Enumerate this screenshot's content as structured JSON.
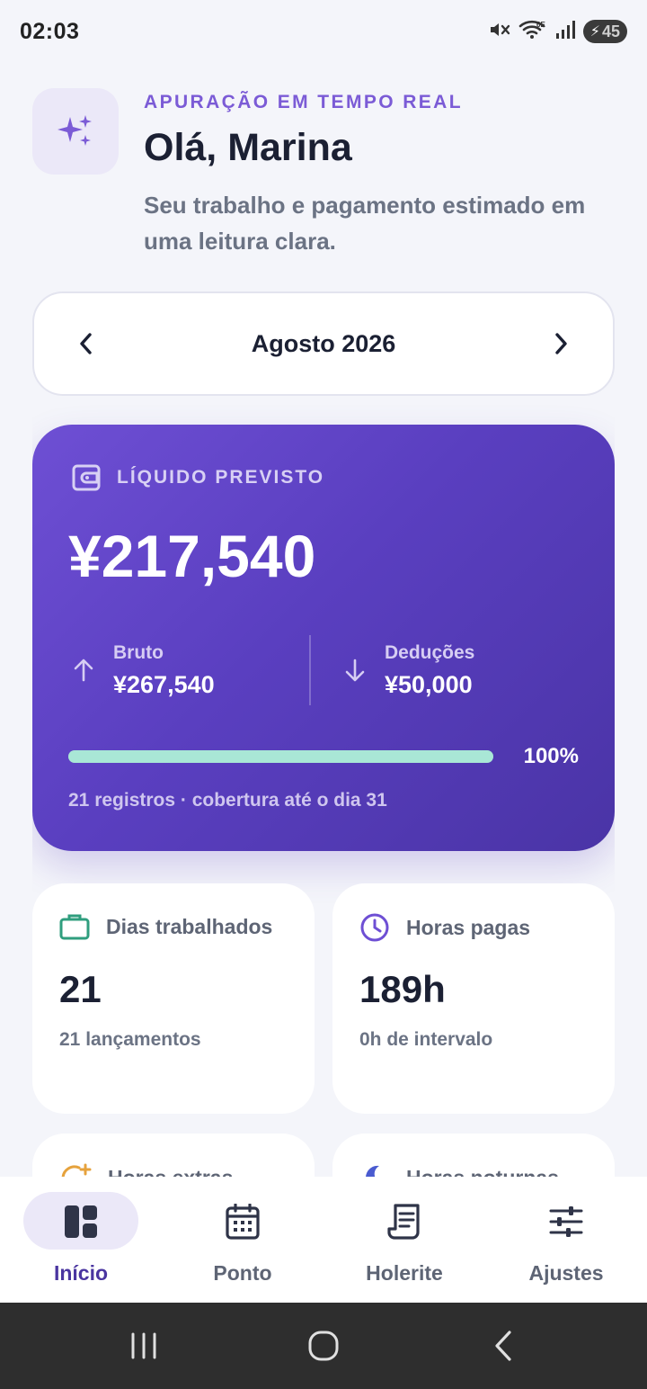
{
  "status_bar": {
    "time": "02:03",
    "battery": "45",
    "icons": [
      "mute-icon",
      "wifi-icon",
      "signal-icon",
      "battery-charging-icon"
    ]
  },
  "header": {
    "eyebrow": "APURAÇÃO EM TEMPO REAL",
    "greeting": "Olá, Marina",
    "subtitle": "Seu trabalho e pagamento estimado em uma leitura clara.",
    "icon": "sparkles-icon"
  },
  "month_selector": {
    "label": "Agosto 2026",
    "prev_icon": "chevron-left-icon",
    "next_icon": "chevron-right-icon"
  },
  "summary": {
    "label": "LÍQUIDO PREVISTO",
    "net_value": "¥217,540",
    "gross_label": "Bruto",
    "gross_value": "¥267,540",
    "deductions_label": "Deduções",
    "deductions_value": "¥50,000",
    "progress_percent": 100,
    "progress_label": "100%",
    "footer": "21 registros · cobertura até o dia 31",
    "accent_color": "#6e4fd4",
    "progress_color": "#a9e7d6"
  },
  "stats": [
    {
      "title": "Dias trabalhados",
      "value": "21",
      "sub": "21 lançamentos",
      "icon": "briefcase-icon",
      "color": "#2f9e7e"
    },
    {
      "title": "Horas pagas",
      "value": "189h",
      "sub": "0h de intervalo",
      "icon": "clock-icon",
      "color": "#6e4fd4"
    },
    {
      "title": "Horas extras",
      "icon": "clock-plus-icon",
      "color": "#e6a23c"
    },
    {
      "title": "Horas noturnas",
      "icon": "moon-icon",
      "color": "#4a5bd0"
    }
  ],
  "bottom_nav": {
    "items": [
      {
        "label": "Início",
        "icon": "dashboard-icon",
        "active": true
      },
      {
        "label": "Ponto",
        "icon": "calendar-icon",
        "active": false
      },
      {
        "label": "Holerite",
        "icon": "receipt-icon",
        "active": false
      },
      {
        "label": "Ajustes",
        "icon": "sliders-icon",
        "active": false
      }
    ]
  },
  "system_nav": [
    "recents-icon",
    "home-icon",
    "back-icon"
  ]
}
